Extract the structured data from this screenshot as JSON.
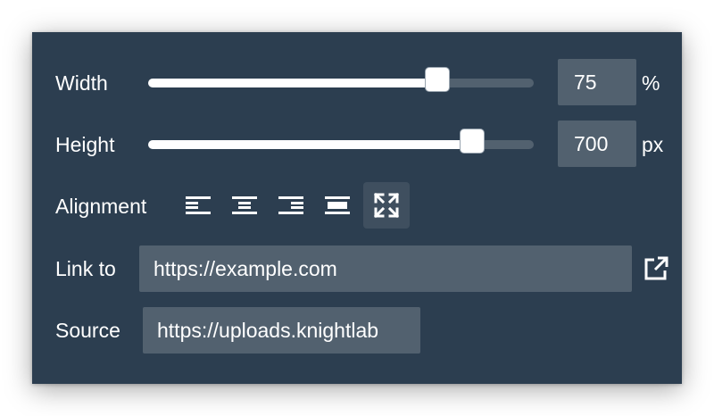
{
  "width": {
    "label": "Width",
    "value": "75",
    "unit": "%",
    "slider_fraction": 0.75
  },
  "height": {
    "label": "Height",
    "value": "700",
    "unit": "px",
    "slider_fraction": 0.84
  },
  "alignment": {
    "label": "Alignment",
    "options": [
      {
        "icon": "align-left-icon",
        "active": false
      },
      {
        "icon": "align-center-icon",
        "active": false
      },
      {
        "icon": "align-right-icon",
        "active": false
      },
      {
        "icon": "align-full-width-icon",
        "active": false
      },
      {
        "icon": "fit-expand-icon",
        "active": true
      }
    ]
  },
  "link": {
    "label": "Link to",
    "value": "https://example.com",
    "open_icon": "external-link-icon"
  },
  "source": {
    "label": "Source",
    "value": "https://uploads.knightlab"
  },
  "colors": {
    "panel_bg": "#2c3e50",
    "field_bg": "#52616f",
    "text": "#ffffff"
  }
}
